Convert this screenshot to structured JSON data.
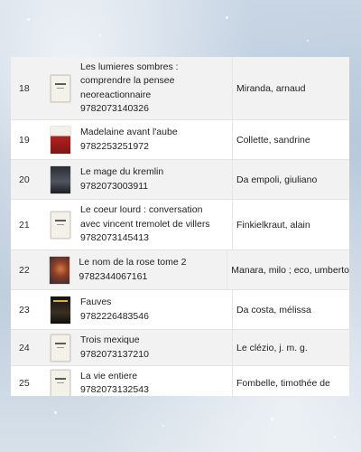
{
  "books": [
    {
      "num": "18",
      "title_lines": [
        "Les lumieres sombres :",
        "comprendre la pensee",
        "neoreactionnaire"
      ],
      "isbn": "9782073140326",
      "author": "Miranda, arnaud",
      "cover_style": "light"
    },
    {
      "num": "19",
      "title_lines": [
        "Madelaine avant l'aube"
      ],
      "isbn": "9782253251972",
      "author": "Collette, sandrine",
      "cover_style": "red"
    },
    {
      "num": "20",
      "title_lines": [
        "Le mage du kremlin"
      ],
      "isbn": "9782073003911",
      "author": "Da empoli, giuliano",
      "cover_style": "dark"
    },
    {
      "num": "21",
      "title_lines": [
        "Le coeur lourd : conversation",
        "avec vincent tremolet de villers"
      ],
      "isbn": "9782073145413",
      "author": "Finkielkraut, alain",
      "cover_style": "light"
    },
    {
      "num": "22",
      "title_lines": [
        "Le nom de la rose tome 2"
      ],
      "isbn": "9782344067161",
      "author": "Manara, milo ; eco, umberto",
      "cover_style": "photo"
    },
    {
      "num": "23",
      "title_lines": [
        "Fauves"
      ],
      "isbn": "9782226483546",
      "author": "Da costa, mélissa",
      "cover_style": "black"
    },
    {
      "num": "24",
      "title_lines": [
        "Trois mexique"
      ],
      "isbn": "9782073137210",
      "author": "Le clézio, j. m. g.",
      "cover_style": "light"
    },
    {
      "num": "25",
      "title_lines": [
        "La vie entiere"
      ],
      "isbn": "9782073132543",
      "author": "Fombelle, timothée de",
      "cover_style": "light"
    }
  ]
}
